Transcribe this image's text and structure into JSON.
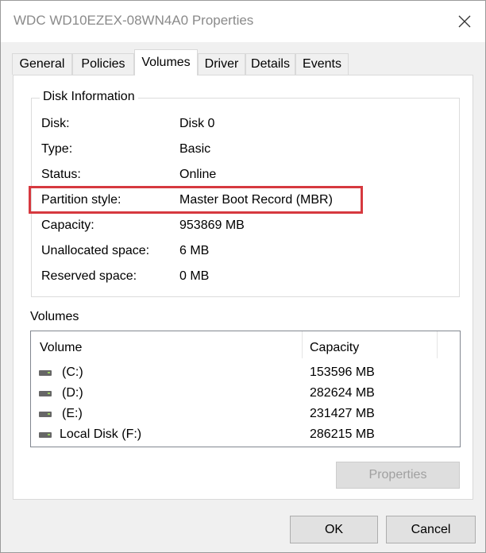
{
  "window": {
    "title": "WDC WD10EZEX-08WN4A0 Properties"
  },
  "tabs": [
    {
      "label": "General"
    },
    {
      "label": "Policies"
    },
    {
      "label": "Volumes"
    },
    {
      "label": "Driver"
    },
    {
      "label": "Details"
    },
    {
      "label": "Events"
    }
  ],
  "active_tab": "Volumes",
  "disk_info": {
    "group_label": "Disk Information",
    "rows": [
      {
        "label": "Disk:",
        "value": "Disk 0"
      },
      {
        "label": "Type:",
        "value": "Basic"
      },
      {
        "label": "Status:",
        "value": "Online"
      },
      {
        "label": "Partition style:",
        "value": "Master Boot Record (MBR)"
      },
      {
        "label": "Capacity:",
        "value": "953869 MB"
      },
      {
        "label": "Unallocated space:",
        "value": "6 MB"
      },
      {
        "label": "Reserved space:",
        "value": "0 MB"
      }
    ],
    "highlight_color": "#d6393f"
  },
  "volumes": {
    "title": "Volumes",
    "columns": [
      "Volume",
      "Capacity"
    ],
    "rows": [
      {
        "name": "(C:)",
        "capacity": "153596 MB"
      },
      {
        "name": "(D:)",
        "capacity": "282624 MB"
      },
      {
        "name": "(E:)",
        "capacity": "231427 MB"
      },
      {
        "name": "Local Disk (F:)",
        "capacity": "286215 MB"
      }
    ],
    "row_icon": "drive-icon"
  },
  "buttons": {
    "properties": "Properties",
    "ok": "OK",
    "cancel": "Cancel"
  }
}
